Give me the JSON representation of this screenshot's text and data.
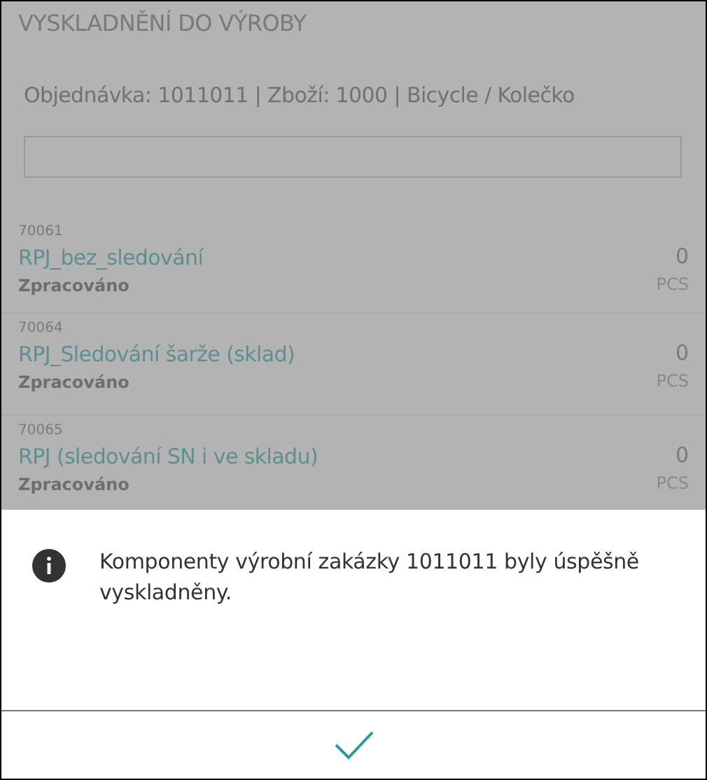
{
  "header": {
    "title": "VYSKLADNĚNÍ DO VÝROBY"
  },
  "order_info": "Objednávka: 1011011 | Zboží: 1000 | Bicycle / Kolečko",
  "items": [
    {
      "code": "70061",
      "name": "RPJ_bez_sledování",
      "status": "Zpracováno",
      "quantity": "0",
      "unit": "PCS"
    },
    {
      "code": "70064",
      "name": "RPJ_Sledování šarže (sklad)",
      "status": "Zpracováno",
      "quantity": "0",
      "unit": "PCS"
    },
    {
      "code": "70065",
      "name": "RPJ (sledování SN i ve skladu)",
      "status": "Zpracováno",
      "quantity": "0",
      "unit": "PCS"
    }
  ],
  "dialog": {
    "message": "Komponenty výrobní zakázky 1011011 byly úspěšně vyskladněny."
  }
}
